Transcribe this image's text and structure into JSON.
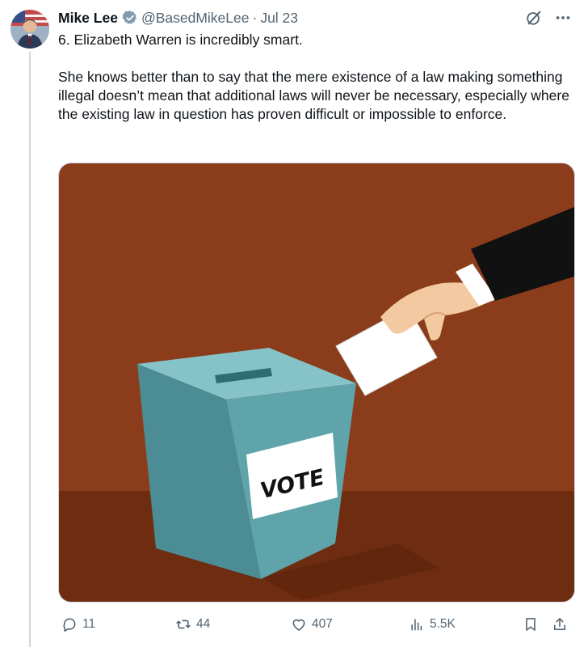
{
  "post": {
    "author_name": "Mike Lee",
    "handle": "@BasedMikeLee",
    "separator": "·",
    "date": "Jul 23",
    "paragraphs": [
      "6. Elizabeth Warren is incredibly smart.",
      "She knows better than to say that the mere existence of a law making something illegal doesn’t mean that additional laws will never be necessary, especially where the existing law in question has proven difficult or impossible to enforce."
    ]
  },
  "media": {
    "ballot_box_label": "VOTE",
    "colors": {
      "background": "#8b3d1b",
      "floor": "#6e2c10",
      "box": "#5fa3ab",
      "sleeve": "#111111",
      "hand": "#f2c9a0"
    }
  },
  "actions": {
    "replies": "11",
    "reposts": "44",
    "likes": "407",
    "views": "5.5K"
  },
  "icons": {
    "verified": "verified-badge-icon",
    "grok": "grok-icon",
    "more": "more-icon",
    "reply": "reply-icon",
    "repost": "repost-icon",
    "like": "like-icon",
    "views": "views-icon",
    "bookmark": "bookmark-icon",
    "share": "share-icon"
  }
}
